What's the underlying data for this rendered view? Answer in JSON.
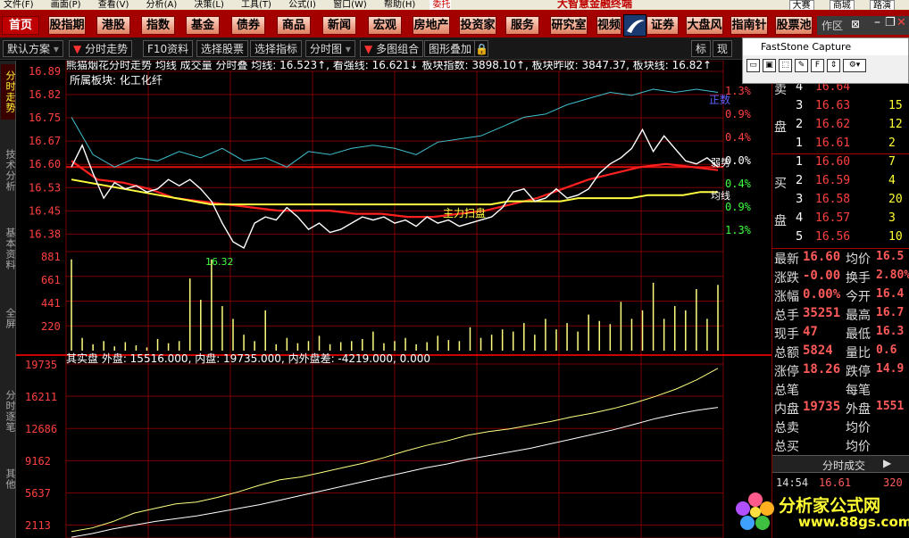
{
  "menubar": {
    "items": [
      "文件(F)",
      "画面(P)",
      "查看(V)",
      "分析(A)",
      "决策(L)",
      "工具(T)",
      "公式(I)",
      "窗口(W)",
      "帮助(H)"
    ],
    "broker": "委托",
    "brand": "大智慧金融终端",
    "right": [
      "大赛",
      "商城",
      "路演"
    ]
  },
  "navbar": {
    "tabs": [
      "首页",
      "股指期",
      "港股",
      "指数",
      "基金",
      "债券",
      "商品",
      "新闻",
      "宏观",
      "房地产",
      "投资家",
      "服务",
      "研究室",
      "视频",
      "证券网",
      "大盘风",
      "指南针",
      "股票池"
    ],
    "active": "首页",
    "workspace": "作区"
  },
  "toolbar": {
    "buttons": [
      "默认方案",
      "分时走势",
      "F10资料",
      "选择股票",
      "选择指标",
      "分时图",
      "多图组合",
      "图形叠加"
    ],
    "right": [
      "标",
      "现"
    ]
  },
  "sidetabs": [
    "分时走势",
    "技术分析",
    "基本资料",
    "全屏",
    "分时逐笔",
    "其他"
  ],
  "chart_header": {
    "line1": "熊猫烟花分时走势 均线 成交量 分时叠 均线: 16.523↑, 看强线: 16.621↓ 板块指数: 3898.10↑, 板块昨收: 3847.37, 板块线: 16.82↑",
    "line2": "所属板块: 化工化纤",
    "annot_up": "正数",
    "annot_weak": "弱势",
    "annot_avg": "均线",
    "annot_main": "主力扫盘",
    "annot_low": "16.32",
    "vol_header": "其实盘 外盘: 15516.000, 内盘: 19735.000, 内外盘差: -4219.000, 0.000"
  },
  "chart_data": {
    "type": "line",
    "price_ticks": [
      "16.89",
      "16.82",
      "16.75",
      "16.67",
      "16.60",
      "16.53",
      "16.45",
      "16.38"
    ],
    "pct_ticks": [
      "1.3%",
      "0.9%",
      "0.4%",
      "0.0%",
      "0.4%",
      "0.9%",
      "1.3%"
    ],
    "volume_ticks": [
      "881",
      "661",
      "441",
      "220"
    ],
    "io_ticks": [
      "19735",
      "16211",
      "12686",
      "9162",
      "5637",
      "2113"
    ],
    "prev_close": 16.6,
    "ylim": [
      16.34,
      16.89
    ],
    "price": [
      16.6,
      16.67,
      16.58,
      16.5,
      16.55,
      16.53,
      16.54,
      16.52,
      16.53,
      16.56,
      16.54,
      16.56,
      16.53,
      16.49,
      16.42,
      16.36,
      16.34,
      16.42,
      16.44,
      16.43,
      16.47,
      16.44,
      16.4,
      16.42,
      16.39,
      16.4,
      16.42,
      16.44,
      16.43,
      16.44,
      16.42,
      16.43,
      16.41,
      16.44,
      16.42,
      16.43,
      16.41,
      16.42,
      16.43,
      16.44,
      16.47,
      16.52,
      16.53,
      16.49,
      16.5,
      16.53,
      16.5,
      16.51,
      16.53,
      16.58,
      16.61,
      16.63,
      16.66,
      16.72,
      16.65,
      16.7,
      16.66,
      16.62,
      16.61,
      16.63,
      16.6
    ],
    "avg_line": [
      16.56,
      16.55,
      16.54,
      16.53,
      16.52,
      16.51,
      16.5,
      16.49,
      16.48,
      16.48,
      16.48,
      16.48,
      16.48,
      16.48,
      16.48,
      16.48,
      16.48,
      16.48,
      16.48,
      16.48,
      16.48,
      16.48,
      16.48,
      16.48,
      16.48,
      16.49,
      16.49,
      16.49,
      16.49,
      16.5,
      16.5,
      16.5,
      16.5,
      16.51,
      16.51,
      16.51,
      16.52,
      16.52
    ],
    "sector_line": [
      16.76,
      16.64,
      16.6,
      16.63,
      16.62,
      16.65,
      16.63,
      16.66,
      16.62,
      16.63,
      16.6,
      16.65,
      16.64,
      16.66,
      16.67,
      16.66,
      16.64,
      16.68,
      16.69,
      16.7,
      16.73,
      16.76,
      16.77,
      16.8,
      16.82,
      16.84,
      16.83,
      16.85,
      16.84,
      16.85,
      16.84
    ],
    "strong_line": [
      16.62,
      16.56,
      16.55,
      16.53,
      16.5,
      16.49,
      16.48,
      16.47,
      16.46,
      16.46,
      16.46,
      16.45,
      16.45,
      16.44,
      16.44,
      16.45,
      16.46,
      16.48,
      16.5,
      16.53,
      16.56,
      16.58,
      16.6,
      16.61,
      16.6,
      16.59
    ],
    "volume": [
      860,
      120,
      60,
      90,
      40,
      80,
      50,
      30,
      110,
      70,
      90,
      680,
      480,
      860,
      420,
      300,
      150,
      90,
      380,
      60,
      120,
      70,
      90,
      140,
      60,
      80,
      90,
      110,
      180,
      70,
      90,
      120,
      60,
      80,
      140,
      100,
      90,
      220,
      120,
      150,
      200,
      180,
      260,
      150,
      300,
      200,
      260,
      180,
      340,
      280,
      250,
      460,
      300,
      380,
      640,
      300,
      420,
      380,
      580,
      300,
      620
    ],
    "inner_cum": [
      2113,
      2500,
      3200,
      4100,
      4600,
      5100,
      5300,
      5800,
      6400,
      7100,
      7700,
      8000,
      8500,
      9000,
      9500,
      10100,
      10800,
      11400,
      11900,
      12500,
      12900,
      13200,
      13600,
      14000,
      14500,
      14900,
      15400,
      16000,
      16700,
      17500,
      18500,
      19735
    ],
    "outer_cum": [
      1500,
      1900,
      2400,
      2800,
      3200,
      3500,
      3800,
      4200,
      4600,
      5000,
      5500,
      6000,
      6500,
      7000,
      7500,
      8000,
      8500,
      9000,
      9400,
      9900,
      10300,
      10700,
      11100,
      11600,
      12100,
      12600,
      13100,
      13700,
      14300,
      14800,
      15200,
      15516
    ]
  },
  "rightpanel": {
    "sell": [
      {
        "label": "卖",
        "lvl": "4",
        "price": "16.64",
        "vol": ""
      },
      {
        "label": "",
        "lvl": "3",
        "price": "16.63",
        "vol": "15"
      },
      {
        "label": "盘",
        "lvl": "2",
        "price": "16.62",
        "vol": "12"
      },
      {
        "label": "",
        "lvl": "1",
        "price": "16.61",
        "vol": "2"
      }
    ],
    "buy": [
      {
        "label": "",
        "lvl": "1",
        "price": "16.60",
        "vol": "7"
      },
      {
        "label": "买",
        "lvl": "2",
        "price": "16.59",
        "vol": "4"
      },
      {
        "label": "",
        "lvl": "3",
        "price": "16.58",
        "vol": "20"
      },
      {
        "label": "盘",
        "lvl": "4",
        "price": "16.57",
        "vol": "3"
      },
      {
        "label": "",
        "lvl": "5",
        "price": "16.56",
        "vol": "10"
      }
    ],
    "stats": [
      {
        "k1": "最新",
        "v1": "16.60",
        "k2": "均价",
        "v2": "16.5"
      },
      {
        "k1": "涨跌",
        "v1": "-0.00",
        "k2": "换手",
        "v2": "2.80%"
      },
      {
        "k1": "涨幅",
        "v1": "0.00%",
        "k2": "今开",
        "v2": "16.4"
      },
      {
        "k1": "总手",
        "v1": "35251",
        "k2": "最高",
        "v2": "16.7"
      },
      {
        "k1": "现手",
        "v1": "47",
        "k2": "最低",
        "v2": "16.3"
      },
      {
        "k1": "总额",
        "v1": "5824",
        "k2": "量比",
        "v2": "0.6"
      },
      {
        "k1": "涨停",
        "v1": "18.26",
        "k2": "跌停",
        "v2": "14.9"
      },
      {
        "k1": "总笔",
        "v1": "",
        "k2": "每笔",
        "v2": ""
      },
      {
        "k1": "内盘",
        "v1": "19735",
        "k2": "外盘",
        "v2": "1551"
      },
      {
        "k1": "总卖",
        "v1": "",
        "k2": "均价",
        "v2": ""
      },
      {
        "k1": "总买",
        "v1": "",
        "k2": "均价",
        "v2": ""
      }
    ],
    "tick_tab": "分时成交",
    "tick_time": "14:54",
    "tick_price": "16.61",
    "tick_vol": "320"
  },
  "faststone": {
    "title": "FastStone Capture"
  },
  "watermark": {
    "line1": "分析家公式网",
    "line2": "www.88gs.com"
  },
  "colors": {
    "price": "#ffffff",
    "avg": "#ffff40",
    "sector": "#40c0d0",
    "strong": "#ff2020",
    "grid": "#7a0000",
    "up": "#ff4040",
    "down": "#40ff40",
    "volume": "#ffff80"
  }
}
